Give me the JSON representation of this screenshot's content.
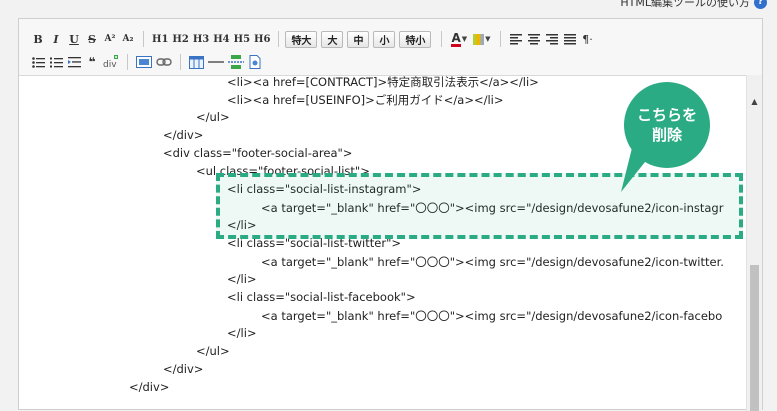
{
  "help": {
    "label": "HTML編集ツールの使い方",
    "icon": "?"
  },
  "toolbar": {
    "row1": {
      "bold": "B",
      "italic": "I",
      "underline": "U",
      "strike": "S",
      "sup": "A²",
      "sub": "A₂",
      "headings": [
        "H1",
        "H2",
        "H3",
        "H4",
        "H5",
        "H6"
      ],
      "sizes": [
        "特大",
        "大",
        "中",
        "小",
        "特小"
      ],
      "font_color": "A",
      "pilcrow": "¶·"
    },
    "row2": {
      "blockquote": "❝",
      "clear_format": "⅍"
    }
  },
  "code_lines": [
    "<li><a href=[CONTRACT]>特定商取引法表示</a></li>",
    "<li><a href=[USEINFO]>ご利用ガイド</a></li>",
    "</ul>",
    "</div>",
    "<div class=\"footer-social-area\">",
    "<ul class=\"footer-social-list\">",
    "<li class=\"social-list-instagram\">",
    "<a target=\"_blank\" href=\"〇〇〇\"><img src=\"/design/devosafune2/icon-instagr",
    "</li>",
    "<li class=\"social-list-twitter\">",
    "<a target=\"_blank\" href=\"〇〇〇\"><img src=\"/design/devosafune2/icon-twitter.",
    "</li>",
    "<li class=\"social-list-facebook\">",
    "<a target=\"_blank\" href=\"〇〇〇\"><img src=\"/design/devosafune2/icon-facebo",
    "</li>",
    "</ul>",
    "</div>",
    "</div>"
  ],
  "callout": {
    "line1": "こちらを",
    "line2": "削除"
  },
  "colors": {
    "accent": "#2bab84",
    "font_color_bar": "#d2001e"
  }
}
